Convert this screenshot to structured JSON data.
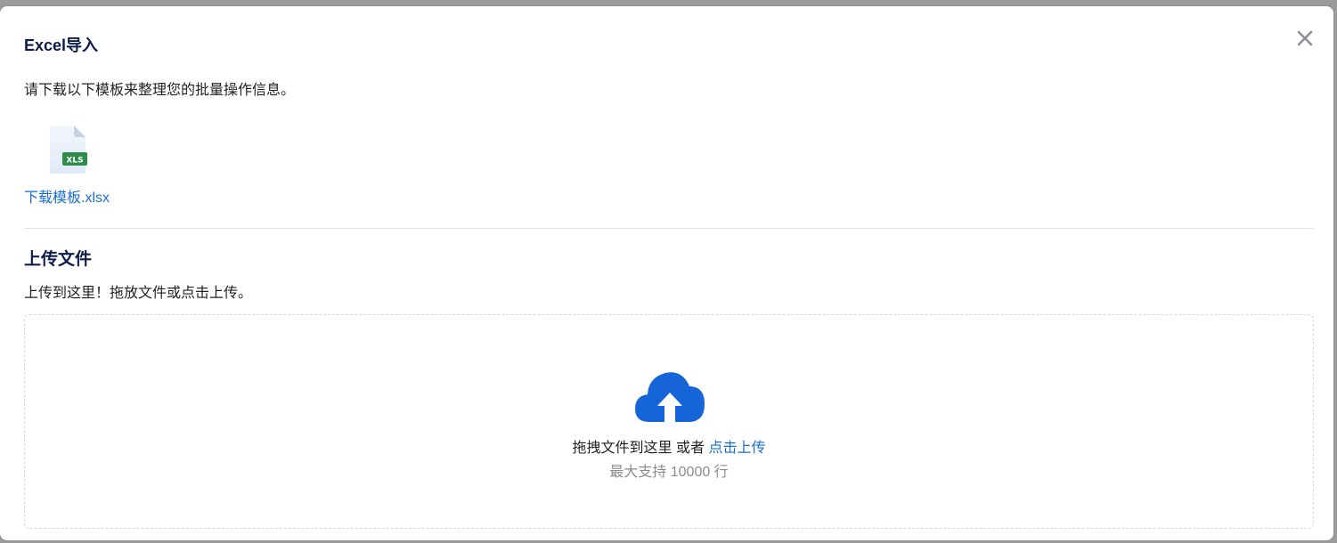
{
  "modal": {
    "title": "Excel导入",
    "close_icon": "close-icon"
  },
  "template": {
    "instruction": "请下载以下模板来整理您的批量操作信息。",
    "file_icon": "xls-file-icon",
    "file_badge": "XLS",
    "download_link": "下载模板.xlsx"
  },
  "upload": {
    "title": "上传文件",
    "description": "上传到这里！拖放文件或点击上传。",
    "cloud_icon": "cloud-upload-icon",
    "drop_text": "拖拽文件到这里 或者 ",
    "click_upload": "点击上传",
    "limit_hint": "最大支持 10000 行"
  },
  "colors": {
    "title": "#0d1b4b",
    "link": "#1a6ecf",
    "accent": "#1565d8",
    "hint": "#8c8c8c",
    "xls_green": "#2e8b4a"
  }
}
